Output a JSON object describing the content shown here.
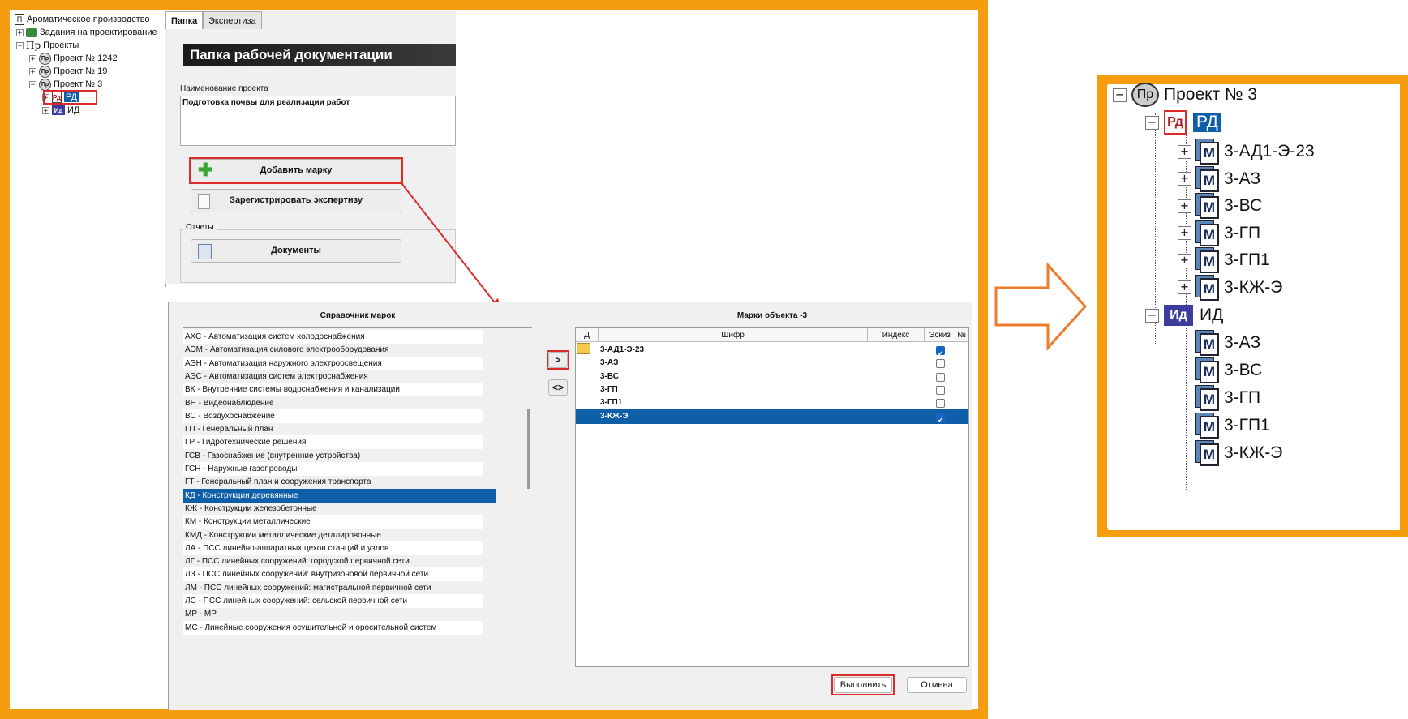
{
  "tree": {
    "root": "Ароматическое производство",
    "items": [
      {
        "label": "Задания на проектирование"
      },
      {
        "label": "Проекты",
        "icon": "Пр"
      },
      {
        "label": "Проект № 1242",
        "icon": "Пр"
      },
      {
        "label": "Проект № 19",
        "icon": "Пр"
      },
      {
        "label": "Проект № 3",
        "icon": "Пр"
      },
      {
        "label": "РД",
        "icon": "Рд"
      },
      {
        "label": "ИД",
        "icon": "Ид"
      }
    ]
  },
  "panel": {
    "tabs": [
      "Папка",
      "Экспертиза"
    ],
    "header": "Папка рабочей документации",
    "project_name_label": "Наименование проекта",
    "project_name_value": "Подготовка почвы для реализации работ",
    "add_mark": "Добавить марку",
    "register_expertise": "Зарегистрировать экспертизу",
    "reports_label": "Отчеты",
    "documents": "Документы"
  },
  "dialog": {
    "left_title": "Справочник марок",
    "right_title": "Марки объекта -3",
    "marks_list": [
      "АХС - Автоматизация систем холодоснабжения",
      "АЭМ - Автоматизация силового электрооборудования",
      "АЭН - Автоматизация наружного электроосвещения",
      "АЭС - Автоматизация систем электроснабжения",
      "ВК - Внутренние системы водоснабжения и канализации",
      "ВН - Видеонаблюдение",
      "ВС - Воздухоснабжение",
      "ГП - Генеральный план",
      "ГР - Гидротехнические решения",
      "ГСВ - Газоснабжение (внутренние устройства)",
      "ГСН - Наружные газопроводы",
      "ГТ - Генеральный план и сооружения транспорта",
      "КД - Конструкции деревянные",
      "КЖ - Конструкции железобетонные",
      "КМ - Конструкции металлические",
      "КМД - Конструкции металлические деталировочные",
      "ЛА - ПСС линейно-аппаратных цехов станций и узлов",
      "ЛГ - ПСС линейных сооружений: городской первичной сети",
      "ЛЗ - ПСС линейных сооружений: внутризоновой первичной сети",
      "ЛМ - ПСС линейных сооружений: магистральной первичной сети",
      "ЛС - ПСС линейных сооружений: сельской первичной сети",
      "МР - МР",
      "МС - Линейные сооружения осушительной и оросительной систем"
    ],
    "selected_mark_index": 12,
    "move_right": ">",
    "move_both": "<>",
    "grid_columns": [
      "Д",
      "Шифр",
      "Индекс",
      "Эскиз",
      "№"
    ],
    "grid_rows": [
      {
        "code": "3-АД1-Э-23",
        "sketch": true
      },
      {
        "code": "3-АЗ",
        "sketch": false
      },
      {
        "code": "3-ВС",
        "sketch": false
      },
      {
        "code": "3-ГП",
        "sketch": false
      },
      {
        "code": "3-ГП1",
        "sketch": false
      },
      {
        "code": "3-КЖ-Э",
        "sketch": true
      }
    ],
    "selected_row_index": 5,
    "execute": "Выполнить",
    "cancel": "Отмена"
  },
  "zoom_tree": {
    "project": "Проект № 3",
    "project_icon": "Пр",
    "rd": "РД",
    "rd_icon": "Рд",
    "rd_children": [
      "3-АД1-Э-23",
      "3-АЗ",
      "3-ВС",
      "3-ГП",
      "3-ГП1",
      "3-КЖ-Э"
    ],
    "id": "ИД",
    "id_icon": "Ид",
    "id_children": [
      "3-АЗ",
      "3-ВС",
      "3-ГП",
      "3-ГП1",
      "3-КЖ-Э"
    ],
    "mark_icon": "М"
  },
  "colors": {
    "frame": "#f59c0f",
    "selection": "#0f5ea8",
    "highlight": "#dc2b2b"
  }
}
